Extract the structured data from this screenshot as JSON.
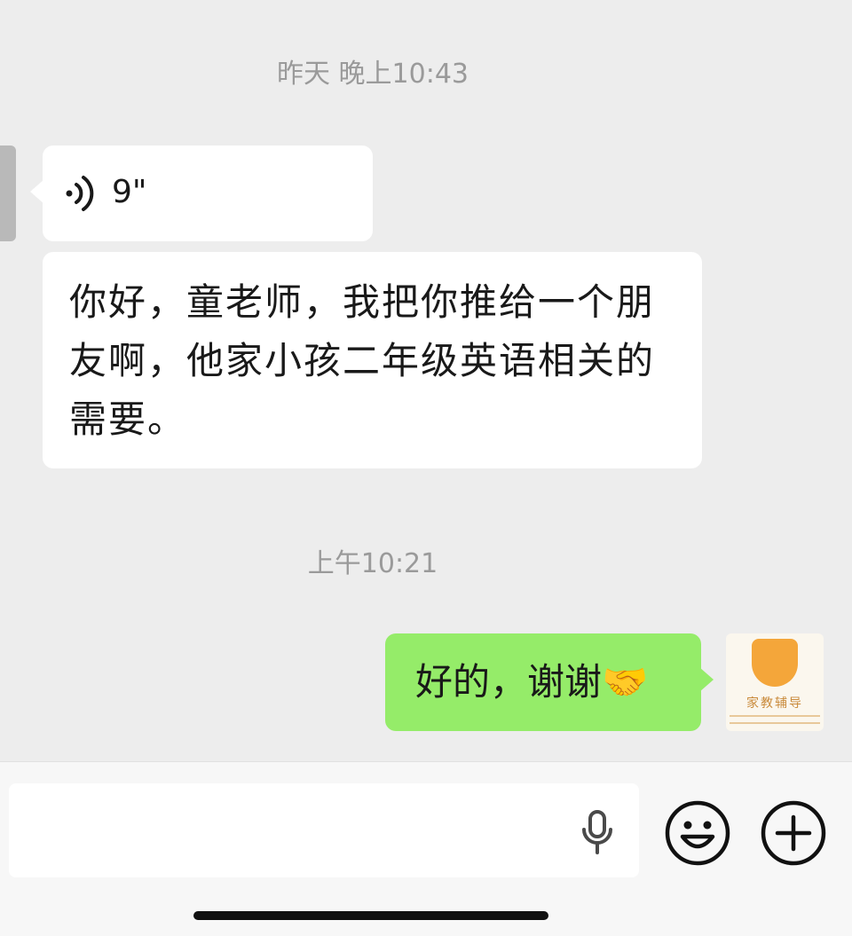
{
  "chat": {
    "timestamp_1": "昨天 晚上10:43",
    "voice_message": {
      "duration": "9\"",
      "icon": "voice-wave-icon"
    },
    "text_message": "你好，童老师，我把你推给一个朋友啊，他家小孩二年级英语相关的需要。",
    "timestamp_2": "上午10:21",
    "outgoing_message": "好的，谢谢🤝",
    "avatar_text": "家教辅导"
  },
  "input_bar": {
    "placeholder": "",
    "mic_icon": "microphone-icon",
    "emoji_icon": "emoji-icon",
    "plus_icon": "plus-icon"
  },
  "colors": {
    "background": "#ededed",
    "incoming_bubble": "#ffffff",
    "outgoing_bubble": "#95ec69"
  }
}
